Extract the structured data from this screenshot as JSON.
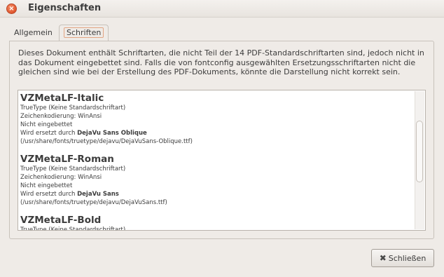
{
  "window": {
    "title": "Eigenschaften",
    "close_glyph": "×"
  },
  "tabs": [
    {
      "label": "Allgemein",
      "selected": false
    },
    {
      "label": "Schriften",
      "selected": true
    }
  ],
  "notice": "Dieses Dokument enthält Schriftarten, die nicht Teil der 14 PDF-Standardschriftarten sind, jedoch nicht in das Dokument eingebettet sind. Falls die von fontconfig ausgewählten Ersetzungsschriftarten nicht die gleichen sind wie bei der Erstellung des PDF-Dokuments, könnte die Darstellung nicht korrekt sein.",
  "fonts": [
    {
      "name": "VZMetaLF-Italic",
      "type": "TrueType (Keine Standardschriftart)",
      "encoding": "Zeichenkodierung: WinAnsi",
      "embedded": "Nicht eingebettet",
      "replaced_prefix": "Wird ersetzt durch ",
      "replacement": "DejaVu Sans Oblique",
      "path": "(/usr/share/fonts/truetype/dejavu/DejaVuSans-Oblique.ttf)"
    },
    {
      "name": "VZMetaLF-Roman",
      "type": "TrueType (Keine Standardschriftart)",
      "encoding": "Zeichenkodierung: WinAnsi",
      "embedded": "Nicht eingebettet",
      "replaced_prefix": "Wird ersetzt durch ",
      "replacement": "DejaVu Sans",
      "path": "(/usr/share/fonts/truetype/dejavu/DejaVuSans.ttf)"
    },
    {
      "name": "VZMetaLF-Bold",
      "type": "TrueType (Keine Standardschriftart)"
    }
  ],
  "buttons": {
    "close_label": "Schließen",
    "close_icon": "✖"
  }
}
